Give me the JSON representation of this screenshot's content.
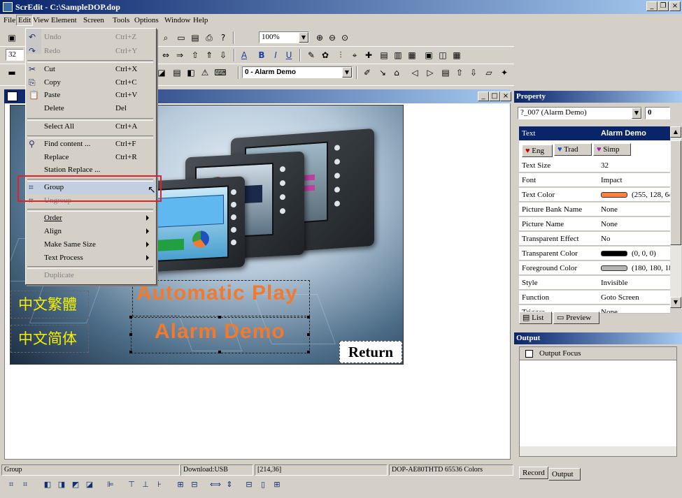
{
  "window": {
    "title": "ScrEdit - C:\\SampleDOP.dop"
  },
  "menubar": {
    "items": [
      "File",
      "Edit",
      "View",
      "Element",
      "Screen",
      "Tools",
      "Options",
      "Window",
      "Help"
    ]
  },
  "toolbar": {
    "zoom": "100%",
    "font_size": "32",
    "screen_select": "0 - Alarm Demo"
  },
  "edit_menu": {
    "items": [
      {
        "label": "Undo",
        "shortcut": "Ctrl+Z",
        "icon": "undo-icon"
      },
      {
        "label": "Redo",
        "shortcut": "Ctrl+Y",
        "icon": "redo-icon"
      },
      {
        "label": "Cut",
        "shortcut": "Ctrl+X",
        "icon": "cut-icon"
      },
      {
        "label": "Copy",
        "shortcut": "Ctrl+C",
        "icon": "copy-icon"
      },
      {
        "label": "Paste",
        "shortcut": "Ctrl+V",
        "icon": "paste-icon"
      },
      {
        "label": "Delete",
        "shortcut": "Del"
      },
      {
        "label": "Select All",
        "shortcut": "Ctrl+A"
      },
      {
        "label": "Find content ...",
        "shortcut": "Ctrl+F",
        "icon": "binoculars-icon"
      },
      {
        "label": "Replace",
        "shortcut": "Ctrl+R"
      },
      {
        "label": "Station Replace ..."
      },
      {
        "label": "Group",
        "icon": "group-icon"
      },
      {
        "label": "Ungroup",
        "icon": "ungroup-icon"
      },
      {
        "label": "Order"
      },
      {
        "label": "Align"
      },
      {
        "label": "Make Same Size"
      },
      {
        "label": "Text Process"
      },
      {
        "label": "Duplicate"
      }
    ]
  },
  "canvas": {
    "title_play": "Automatic Play",
    "title_alarm": "Alarm Demo",
    "trad_chinese": "中文繁體",
    "simp_chinese": "中文简体",
    "return_label": "Return"
  },
  "property": {
    "title": "Property",
    "object": "?_007 (Alarm Demo)",
    "index": "0",
    "text_key": "Text",
    "text_value": "Alarm Demo",
    "langs": [
      "Eng",
      "Trad",
      "Simp"
    ],
    "rows": [
      {
        "key": "Text Size",
        "value": "32"
      },
      {
        "key": "Font",
        "value": "Impact"
      },
      {
        "key": "Text Color",
        "value": "(255, 128, 64",
        "color": "#ff8040"
      },
      {
        "key": "Picture Bank Name",
        "value": "None"
      },
      {
        "key": "Picture Name",
        "value": "None"
      },
      {
        "key": "Transparent Effect",
        "value": "No"
      },
      {
        "key": "Transparent Color",
        "value": "(0, 0, 0)",
        "color": "#000000"
      },
      {
        "key": "Foreground Color",
        "value": "(180, 180, 18",
        "color": "#b4b4b4"
      },
      {
        "key": "Style",
        "value": "Invisible"
      },
      {
        "key": "Function",
        "value": "Goto Screen"
      },
      {
        "key": "Trigger",
        "value": "None"
      }
    ],
    "tabs": [
      "List",
      "Preview"
    ]
  },
  "output": {
    "title": "Output",
    "header": "Output Focus",
    "tabs": [
      "Record",
      "Output"
    ]
  },
  "statusbar": {
    "mode": "Group",
    "download": "Download:USB",
    "coords": "[214,36]",
    "device": "DOP-AE80THTD 65536 Colors"
  }
}
